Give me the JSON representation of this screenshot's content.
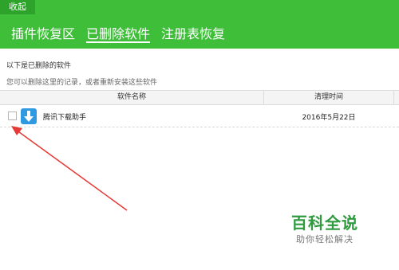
{
  "header": {
    "collapse_label": "收起",
    "tabs": [
      {
        "label": "插件恢复区"
      },
      {
        "label": "已删除软件"
      },
      {
        "label": "注册表恢复"
      }
    ]
  },
  "info": {
    "title": "以下是已删除的软件",
    "subtitle": "您可以删除这里的记录，或者重新安装这些软件"
  },
  "table": {
    "columns": [
      "软件名称",
      "清理时间"
    ],
    "rows": [
      {
        "name": "腾讯下载助手",
        "time": "2016年5月22日",
        "icon": "download-arrow-icon"
      }
    ]
  },
  "watermark": {
    "title": "百科全说",
    "subtitle": "助你轻松解决"
  },
  "colors": {
    "header": "#3fbe3a",
    "accent_icon": "#2f9ae2",
    "annotation_arrow": "#e53935",
    "watermark": "#2e9b3f"
  }
}
